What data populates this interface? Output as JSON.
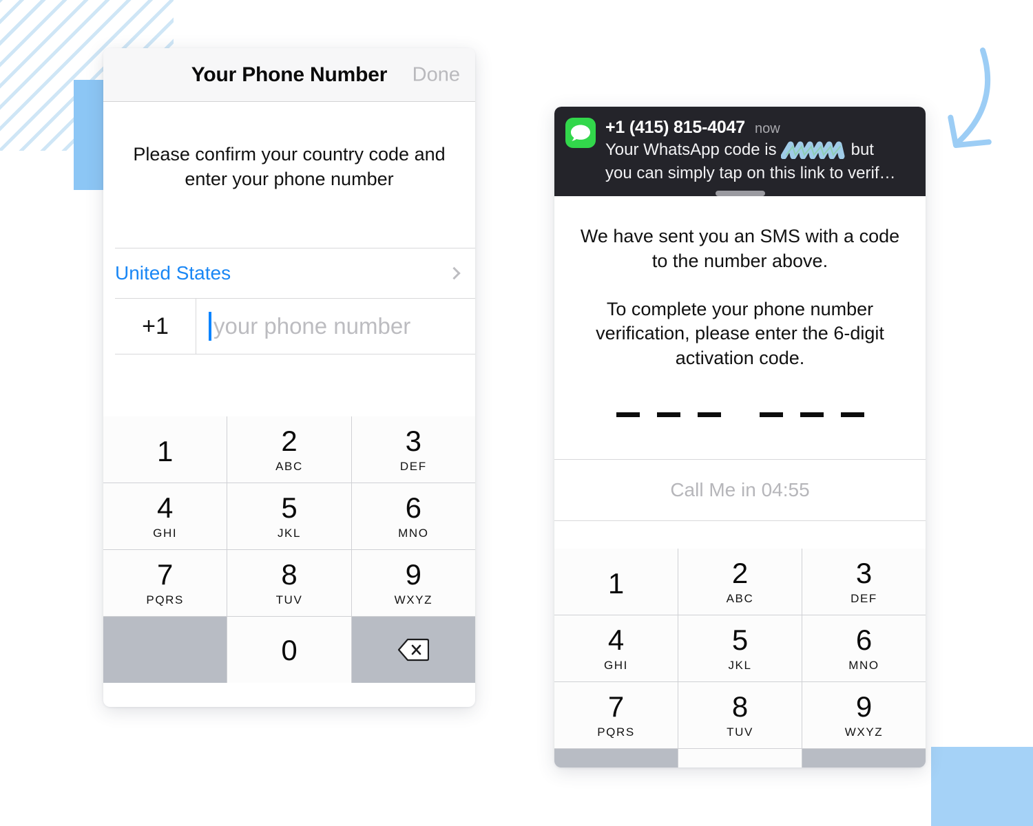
{
  "decor": {
    "stripe_color": "#cfe6f6",
    "accent_blue": "#8cc6f5",
    "square_blue": "#a5d2f7",
    "arrow_color": "#9ccdf5"
  },
  "left_screen": {
    "nav": {
      "title": "Your Phone Number",
      "done_label": "Done"
    },
    "hint": "Please confirm your country code and enter your phone number",
    "country": {
      "name": "United States"
    },
    "phone_field": {
      "country_code": "+1",
      "placeholder": "your phone number",
      "value": ""
    }
  },
  "right_screen": {
    "notification": {
      "app_icon": "messages-icon",
      "sender": "+1 (415) 815-4047",
      "time": "now",
      "line1_before": "Your WhatsApp code is",
      "line1_after": "but",
      "line2": "you can simply tap on this link to verif…",
      "redacted": true
    },
    "body_paragraph_1": "We have sent you an SMS with a code to the number above.",
    "body_paragraph_2": "To complete your phone number verification, please enter the 6-digit activation code.",
    "code_field": {
      "digits": 6,
      "entered": "",
      "placeholder_char": "-"
    },
    "call_me": "Call Me in 04:55"
  },
  "keypad": {
    "keys": [
      {
        "digit": "1",
        "letters": ""
      },
      {
        "digit": "2",
        "letters": "ABC"
      },
      {
        "digit": "3",
        "letters": "DEF"
      },
      {
        "digit": "4",
        "letters": "GHI"
      },
      {
        "digit": "5",
        "letters": "JKL"
      },
      {
        "digit": "6",
        "letters": "MNO"
      },
      {
        "digit": "7",
        "letters": "PQRS"
      },
      {
        "digit": "8",
        "letters": "TUV"
      },
      {
        "digit": "9",
        "letters": "WXYZ"
      },
      {
        "digit": "0",
        "letters": ""
      }
    ],
    "delete_icon": "backspace-icon",
    "blank_key": ""
  }
}
